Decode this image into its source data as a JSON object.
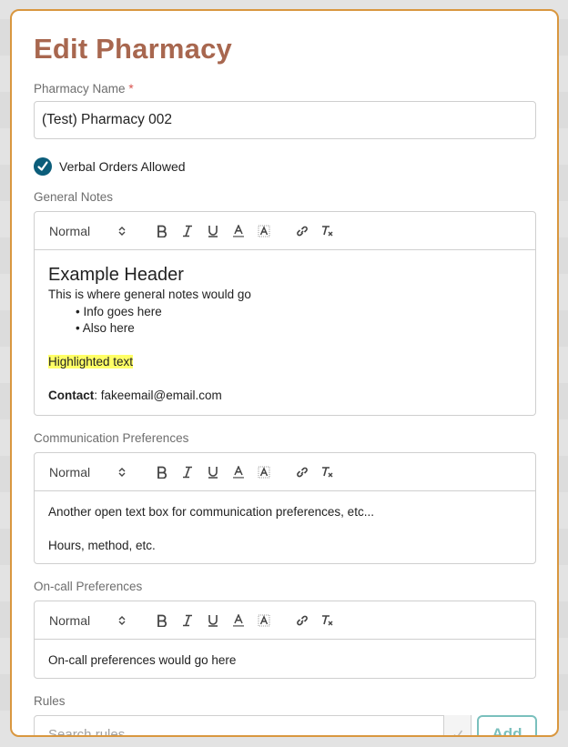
{
  "modal": {
    "title": "Edit Pharmacy"
  },
  "name_field": {
    "label": "Pharmacy Name",
    "required_marker": "*",
    "value": "(Test) Pharmacy 002"
  },
  "verbal_orders": {
    "label": "Verbal Orders Allowed",
    "checked": true
  },
  "toolbar": {
    "format_select": "Normal",
    "buttons": [
      "bold",
      "italic",
      "underline",
      "text-color",
      "background-color",
      "link",
      "clear-format"
    ]
  },
  "general_notes": {
    "label": "General Notes",
    "header": "Example Header",
    "line1": "This is where general notes would go",
    "bullets": [
      "Info goes here",
      "Also here"
    ],
    "highlight": "Highlighted text",
    "contact_label": "Contact",
    "contact_value": ": fakeemail@email.com"
  },
  "communication": {
    "label": "Communication Preferences",
    "line1": "Another open text box for communication preferences, etc...",
    "line2": "Hours, method, etc."
  },
  "oncall": {
    "label": "On-call Preferences",
    "line1": "On-call preferences would go here"
  },
  "rules": {
    "label": "Rules",
    "placeholder": "Search rules",
    "add_label": "Add"
  },
  "colors": {
    "title": "#a8674f",
    "border": "#d9973f",
    "checkbox": "#0b5d7a",
    "add_button": "#7ac0bd",
    "highlight": "#ffff66"
  }
}
